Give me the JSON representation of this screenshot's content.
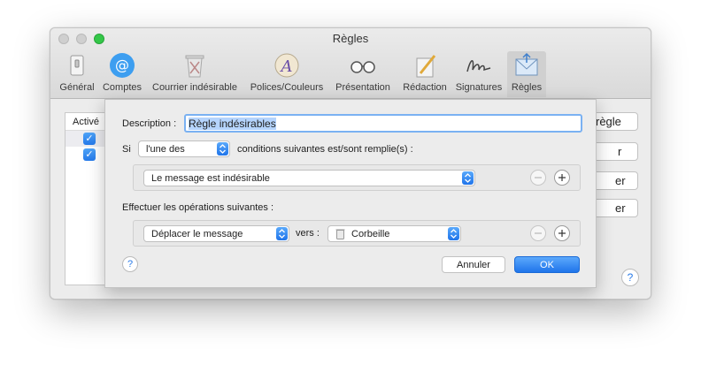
{
  "window": {
    "title": "Règles"
  },
  "toolbar": {
    "items": [
      {
        "label": "Général",
        "icon": "switch-icon"
      },
      {
        "label": "Comptes",
        "icon": "at-sign-icon"
      },
      {
        "label": "Courrier indésirable",
        "icon": "junk-trash-icon"
      },
      {
        "label": "Polices/Couleurs",
        "icon": "font-colors-icon"
      },
      {
        "label": "Présentation",
        "icon": "glasses-icon"
      },
      {
        "label": "Rédaction",
        "icon": "pencil-paper-icon"
      },
      {
        "label": "Signatures",
        "icon": "signature-icon"
      },
      {
        "label": "Règles",
        "icon": "rules-envelope-icon"
      }
    ],
    "selected": "Règles"
  },
  "rules_list": {
    "header": "Activé",
    "rows": [
      {
        "checked": true
      },
      {
        "checked": true
      }
    ],
    "side_buttons": [
      "règle",
      "r",
      "er",
      "er"
    ]
  },
  "sheet": {
    "description_label": "Description :",
    "description_value": "Règle indésirables",
    "si_label": "Si",
    "match_popup": "l'une des",
    "conditions_text": "conditions suivantes est/sont remplie(s) :",
    "condition_popup": "Le message est indésirable",
    "actions_label": "Effectuer les opérations suivantes :",
    "action_popup": "Déplacer le message",
    "vers_label": "vers :",
    "mailbox_popup": "Corbeille",
    "cancel": "Annuler",
    "ok": "OK",
    "help": "?"
  },
  "main_help": "?",
  "colors": {
    "accent": "#2479ea",
    "selection": "#b5d4fd",
    "focus_ring": "#7ab1f2",
    "close_disabled": "#cfcfcf",
    "zoom_green": "#34c748"
  }
}
